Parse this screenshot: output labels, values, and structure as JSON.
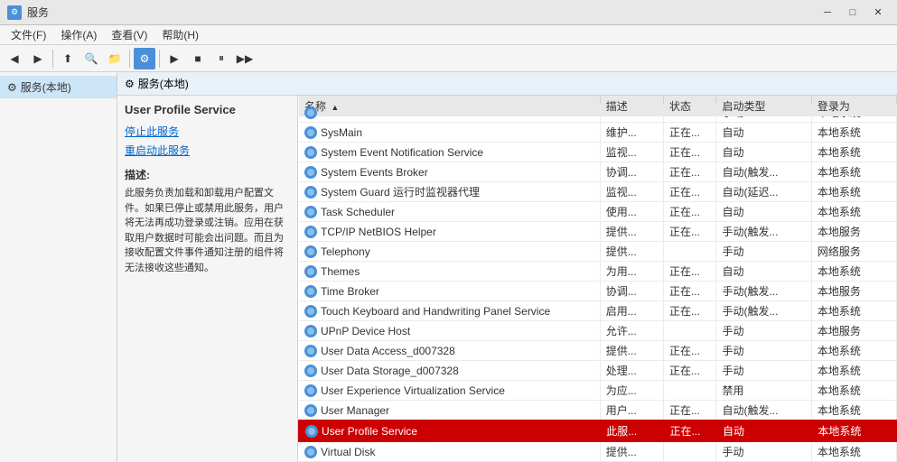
{
  "window": {
    "title": "服务",
    "icon": "⚙"
  },
  "titlebar": {
    "minimize": "─",
    "maximize": "□",
    "close": "✕"
  },
  "menu": {
    "items": [
      "文件(F)",
      "操作(A)",
      "查看(V)",
      "帮助(H)"
    ]
  },
  "leftPanel": {
    "items": [
      {
        "label": "服务(本地)",
        "selected": true
      }
    ]
  },
  "rightHeader": {
    "label": "服务(本地)"
  },
  "serviceDescription": {
    "title": "User Profile Service",
    "stopLink": "停止此服务",
    "restartLink": "重启动此服务",
    "descLabel": "描述:",
    "descText": "此服务负责加载和卸载用户配置文件。如果已停止或禁用此服务，用户将无法再成功登录或注销。应用在获取用户数据时可能会出问题。而且为接收配置文件事件通知注册的组件将无法接收这些通知。"
  },
  "table": {
    "headers": [
      "名称",
      "描述",
      "状态",
      "启动类型",
      "登录为"
    ],
    "sortColumn": "名称",
    "rows": [
      {
        "name": "SwitchBoard",
        "desc": "",
        "status": "",
        "startup": "手动",
        "login": "本地系统"
      },
      {
        "name": "SysMain",
        "desc": "维护...",
        "status": "正在...",
        "startup": "自动",
        "login": "本地系统"
      },
      {
        "name": "System Event Notification Service",
        "desc": "监视...",
        "status": "正在...",
        "startup": "自动",
        "login": "本地系统"
      },
      {
        "name": "System Events Broker",
        "desc": "协调...",
        "status": "正在...",
        "startup": "自动(触发...",
        "login": "本地系统"
      },
      {
        "name": "System Guard 运行时监视器代理",
        "desc": "监视...",
        "status": "正在...",
        "startup": "自动(延迟...",
        "login": "本地系统"
      },
      {
        "name": "Task Scheduler",
        "desc": "使用...",
        "status": "正在...",
        "startup": "自动",
        "login": "本地系统"
      },
      {
        "name": "TCP/IP NetBIOS Helper",
        "desc": "提供...",
        "status": "正在...",
        "startup": "手动(触发...",
        "login": "本地服务"
      },
      {
        "name": "Telephony",
        "desc": "提供...",
        "status": "",
        "startup": "手动",
        "login": "网络服务"
      },
      {
        "name": "Themes",
        "desc": "为用...",
        "status": "正在...",
        "startup": "自动",
        "login": "本地系统"
      },
      {
        "name": "Time Broker",
        "desc": "协调...",
        "status": "正在...",
        "startup": "手动(触发...",
        "login": "本地服务"
      },
      {
        "name": "Touch Keyboard and Handwriting Panel Service",
        "desc": "启用...",
        "status": "正在...",
        "startup": "手动(触发...",
        "login": "本地系统"
      },
      {
        "name": "UPnP Device Host",
        "desc": "允许...",
        "status": "",
        "startup": "手动",
        "login": "本地服务"
      },
      {
        "name": "User Data Access_d007328",
        "desc": "提供...",
        "status": "正在...",
        "startup": "手动",
        "login": "本地系统"
      },
      {
        "name": "User Data Storage_d007328",
        "desc": "处理...",
        "status": "正在...",
        "startup": "手动",
        "login": "本地系统"
      },
      {
        "name": "User Experience Virtualization Service",
        "desc": "为应...",
        "status": "",
        "startup": "禁用",
        "login": "本地系统"
      },
      {
        "name": "User Manager",
        "desc": "用户...",
        "status": "正在...",
        "startup": "自动(触发...",
        "login": "本地系统"
      },
      {
        "name": "User Profile Service",
        "desc": "此服...",
        "status": "正在...",
        "startup": "自动",
        "login": "本地系统",
        "selected": true
      },
      {
        "name": "Virtual Disk",
        "desc": "提供...",
        "status": "",
        "startup": "手动",
        "login": "本地系统"
      }
    ]
  }
}
